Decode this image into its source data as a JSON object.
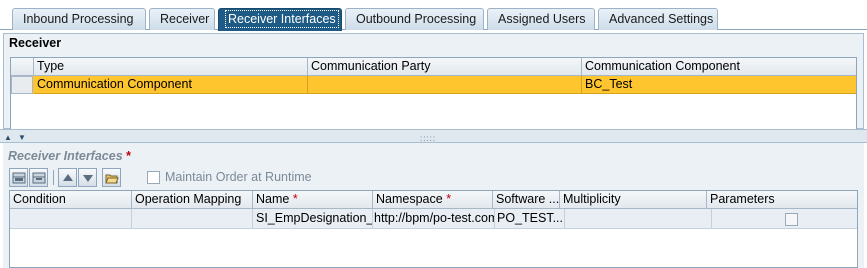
{
  "tabs": [
    {
      "label": "Inbound Processing",
      "active": false
    },
    {
      "label": "Receiver",
      "active": false
    },
    {
      "label": "Receiver Interfaces",
      "active": true
    },
    {
      "label": "Outbound Processing",
      "active": false
    },
    {
      "label": "Assigned Users",
      "active": false
    },
    {
      "label": "Advanced Settings",
      "active": false
    }
  ],
  "receiver": {
    "title": "Receiver",
    "columns": [
      "Type",
      "Communication Party",
      "Communication Component"
    ],
    "rows": [
      {
        "type": "Communication Component",
        "party": "",
        "component": "BC_Test",
        "selected": true
      }
    ]
  },
  "splitter": {
    "grip": ":::::"
  },
  "receiver_interfaces": {
    "title": "Receiver Interfaces",
    "required_marker": "*",
    "toolbar": {
      "icons": [
        "insert-row-icon",
        "delete-row-icon",
        "move-up-icon",
        "move-down-icon",
        "open-folder-icon"
      ],
      "maintain_order_label": "Maintain Order at Runtime",
      "maintain_order_checked": false
    },
    "columns": [
      {
        "label": "Condition",
        "required": false
      },
      {
        "label": "Operation Mapping",
        "required": false
      },
      {
        "label": "Name",
        "required": true
      },
      {
        "label": "Namespace",
        "required": true
      },
      {
        "label": "Software ...",
        "required": false
      },
      {
        "label": "Multiplicity",
        "required": false
      },
      {
        "label": "Parameters",
        "required": false
      }
    ],
    "rows": [
      {
        "condition": "",
        "operation_mapping": "",
        "name": "SI_EmpDesignation_I",
        "namespace": "http://bpm/po-test.com",
        "software": "PO_TEST...",
        "multiplicity": "",
        "parameters": false
      }
    ]
  },
  "colors": {
    "active_tab": "#1d5b86",
    "selected_row": "#ffc52f",
    "required": "#c0000b"
  }
}
